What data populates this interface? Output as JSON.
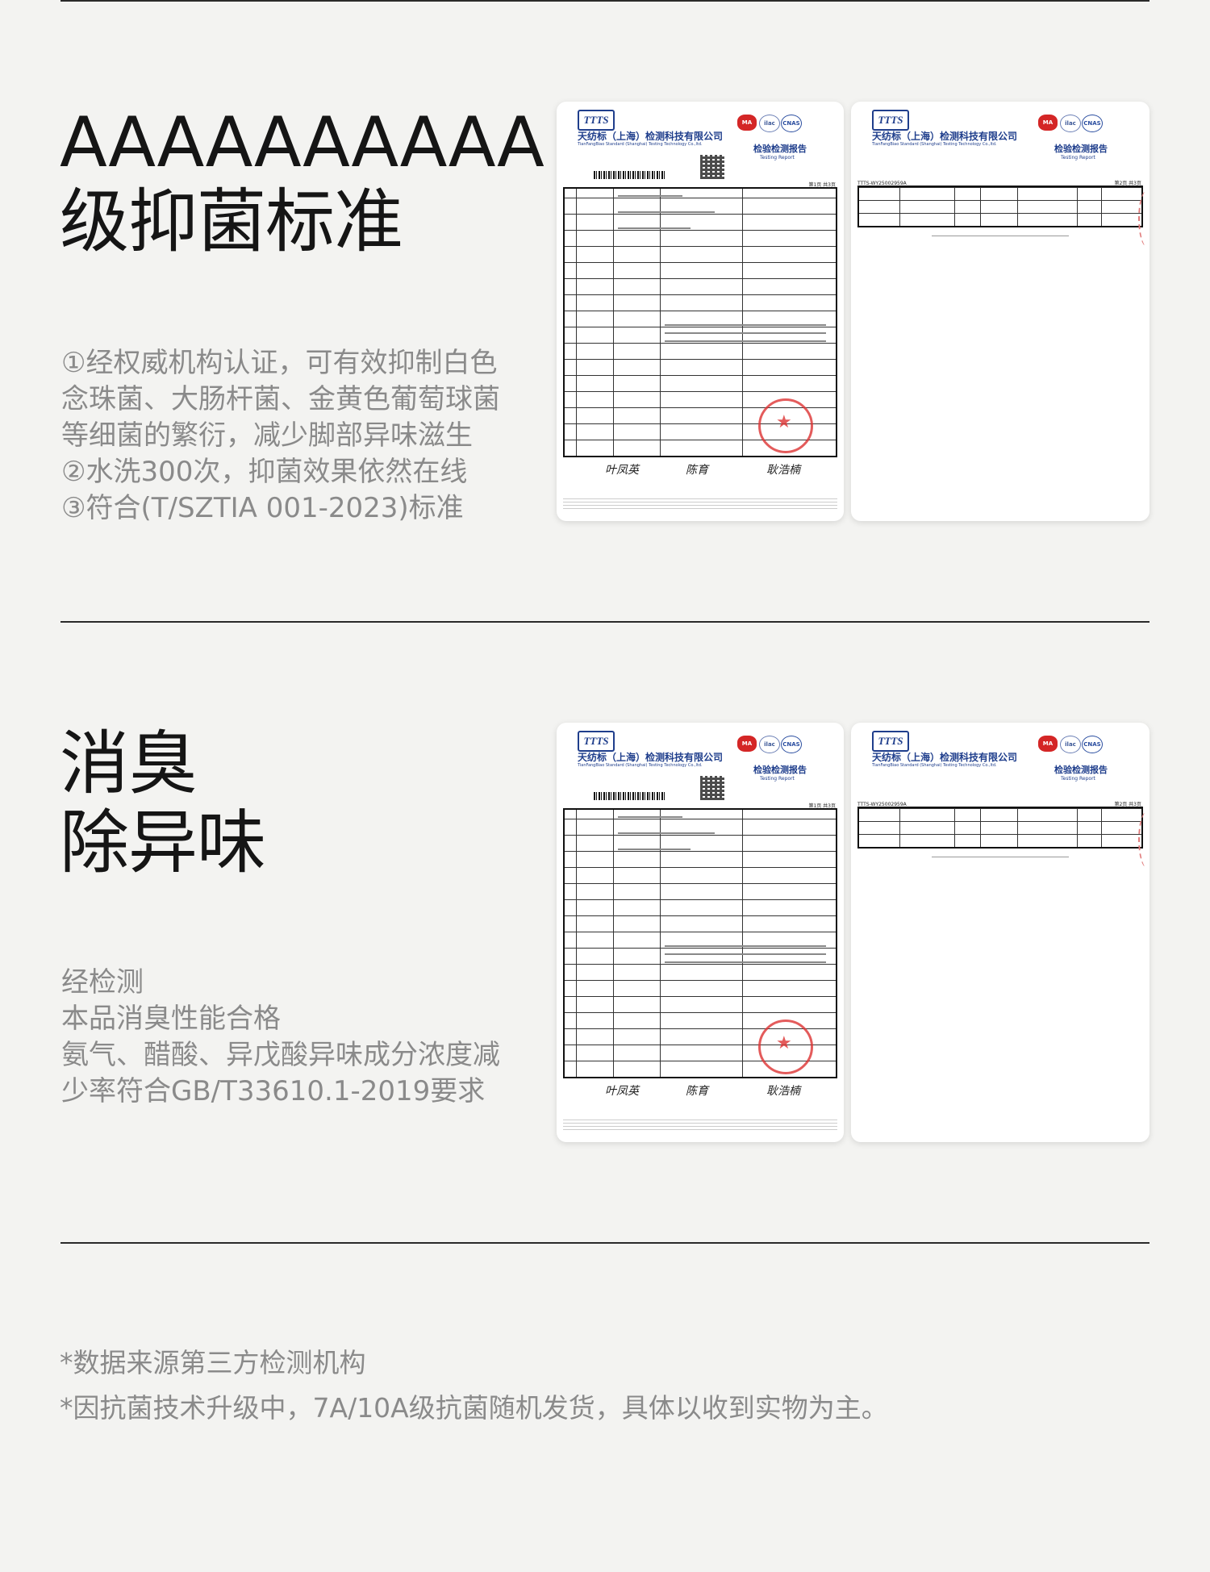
{
  "section1": {
    "headline_line1": "AAAAAAAAAA",
    "headline_line2": "级抑菌标准",
    "desc": [
      "①经权威机构认证，可有效抑制白色",
      "念珠菌、大肠杆菌、金黄色葡萄球菌",
      "等细菌的繁衍，减少脚部异味滋生",
      "②水洗300次，抑菌效果依然在线",
      "③符合(T/SZTIA 001-2023)标准"
    ]
  },
  "section2": {
    "headline_line1": "消臭",
    "headline_line2": "除异味",
    "desc": [
      "经检测",
      "本品消臭性能合格",
      "氨气、醋酸、异戊酸异味成分浓度减",
      "少率符合GB/T33610.1-2019要求"
    ]
  },
  "report": {
    "logo": "TTTS",
    "org": "天纺标（上海）检测科技有限公司",
    "org_en": "TianFangBiao Standard (Shanghai) Testing Technology Co.,ltd.",
    "title": "检验检测报告",
    "title_en": "Testing Report",
    "badge_ma": "MA",
    "badge_ilac": "ilac",
    "badge_cnas": "CNAS",
    "page1": "第1页 共3页",
    "page2": "第2页 共3页",
    "report_no": "TTTS-WY25002959A",
    "signatures": [
      "叶凤英",
      "陈育",
      "耿浩楠"
    ]
  },
  "footnotes": [
    "*数据来源第三方检测机构",
    "*因抗菌技术升级中，7A/10A级抗菌随机发货，具体以收到实物为主。"
  ]
}
